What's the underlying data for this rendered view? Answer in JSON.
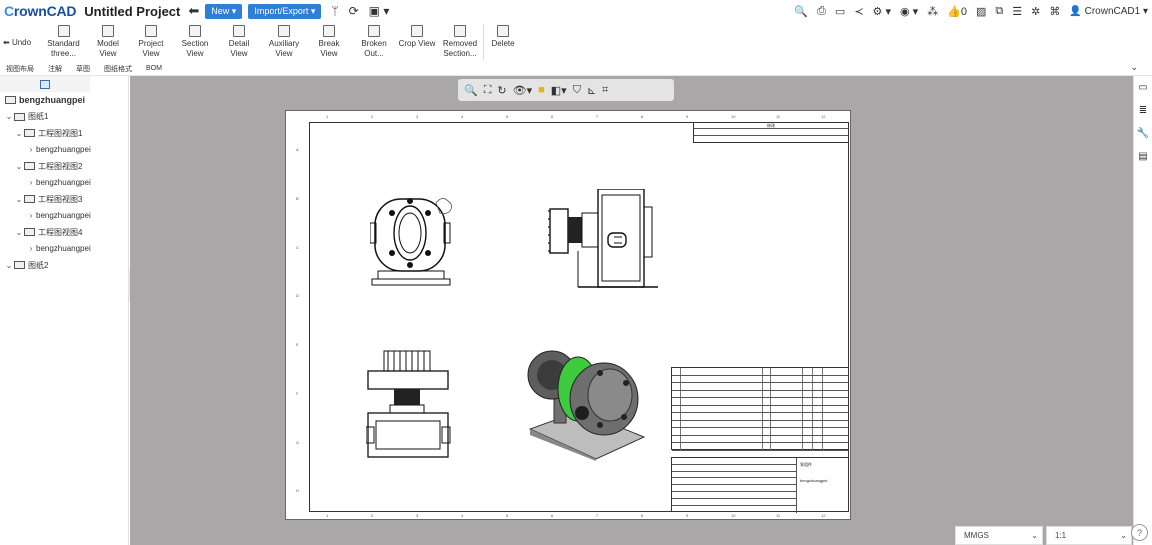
{
  "app": {
    "logo_prefix": "C",
    "logo_rest": "rownCAD",
    "project_title": "Untitled Project",
    "new_label": "New",
    "import_export_label": "Import/Export",
    "user": "CrownCAD1",
    "likes": "0"
  },
  "ribbon": {
    "undo_label": "Undo",
    "buttons": [
      {
        "line1": "Standard",
        "line2": "three..."
      },
      {
        "line1": "Model",
        "line2": "View"
      },
      {
        "line1": "Project",
        "line2": "View"
      },
      {
        "line1": "Section",
        "line2": "View"
      },
      {
        "line1": "Detail",
        "line2": "View"
      },
      {
        "line1": "Auxiliary",
        "line2": "View"
      },
      {
        "line1": "Break",
        "line2": "View"
      },
      {
        "line1": "Broken",
        "line2": "Out..."
      },
      {
        "line1": "Crop View",
        "line2": ""
      },
      {
        "line1": "Removed",
        "line2": "Section..."
      },
      {
        "line1": "Delete",
        "line2": ""
      }
    ]
  },
  "tabs": [
    "视图布局",
    "注解",
    "草图",
    "图纸格式",
    "BOM"
  ],
  "tree": {
    "root": "bengzhuangpei",
    "sheet1": "图纸1",
    "views": [
      {
        "label": "工程图视图1",
        "child": "bengzhuangpei"
      },
      {
        "label": "工程图视图2",
        "child": "bengzhuangpei"
      },
      {
        "label": "工程图视图3",
        "child": "bengzhuangpei"
      },
      {
        "label": "工程图视图4",
        "child": "bengzhuangpei"
      }
    ],
    "sheet2": "图纸2"
  },
  "status": {
    "units": "MMGS",
    "scale": "1:1"
  },
  "drawing": {
    "zone_cols": [
      "1",
      "2",
      "3",
      "4",
      "5",
      "6",
      "7",
      "8",
      "9",
      "10",
      "11",
      "12"
    ],
    "zone_rows": [
      "A",
      "B",
      "C",
      "D",
      "E",
      "F",
      "G",
      "H"
    ],
    "revision_title": "修改",
    "title_block_name": "bengzhuangpei",
    "title_block_label": "泵组件"
  },
  "colors": {
    "accent": "#2f7ed8",
    "canvas": "#a9a7a7",
    "highlight": "#3ecb3e"
  }
}
